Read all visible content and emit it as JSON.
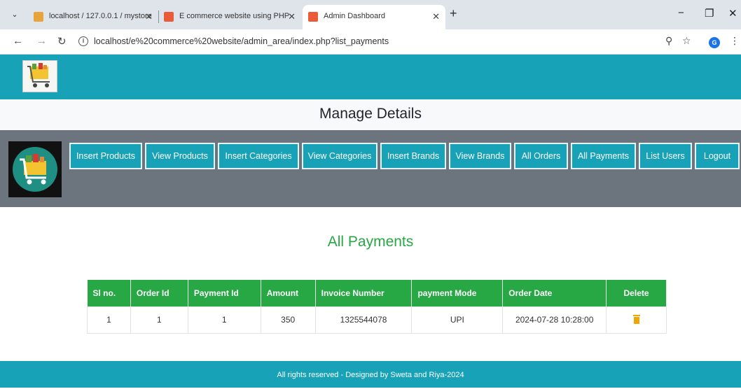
{
  "browser": {
    "tabs": [
      {
        "title": "localhost / 127.0.0.1 / mystore",
        "close": "✕",
        "favicon_color": "#e9a33b"
      },
      {
        "title": "E commerce website using PHP",
        "close": "✕",
        "favicon_color": "#ea5b38"
      },
      {
        "title": "Admin Dashboard",
        "close": "✕",
        "favicon_color": "#ea5b38"
      }
    ],
    "new_tab": "+",
    "url": "localhost/e%20commerce%20website/admin_area/index.php?list_payments",
    "profile_initial": "G"
  },
  "page": {
    "title": "Manage Details",
    "nav_buttons": [
      "Insert Products",
      "View Products",
      "Insert Categories",
      "View Categories",
      "Insert Brands",
      "View Brands",
      "All Orders",
      "All Payments",
      "List Users",
      "Logout"
    ],
    "heading": "All Payments",
    "table": {
      "headers": [
        "Sl no.",
        "Order Id",
        "Payment Id",
        "Amount",
        "Invoice Number",
        "payment Mode",
        "Order Date",
        "Delete"
      ],
      "rows": [
        {
          "sl_no": "1",
          "order_id": "1",
          "payment_id": "1",
          "amount": "350",
          "invoice_number": "1325544078",
          "payment_mode": "UPI",
          "order_date": "2024-07-28 10:28:00",
          "delete_icon": "trash-icon"
        }
      ]
    },
    "footer": "All rights reserved - Designed by Sweta and Riya-2024"
  },
  "colors": {
    "accent": "#17a2b8",
    "nav_band": "#6c757d",
    "success": "#28a745",
    "delete_icon": "#f0a500"
  }
}
